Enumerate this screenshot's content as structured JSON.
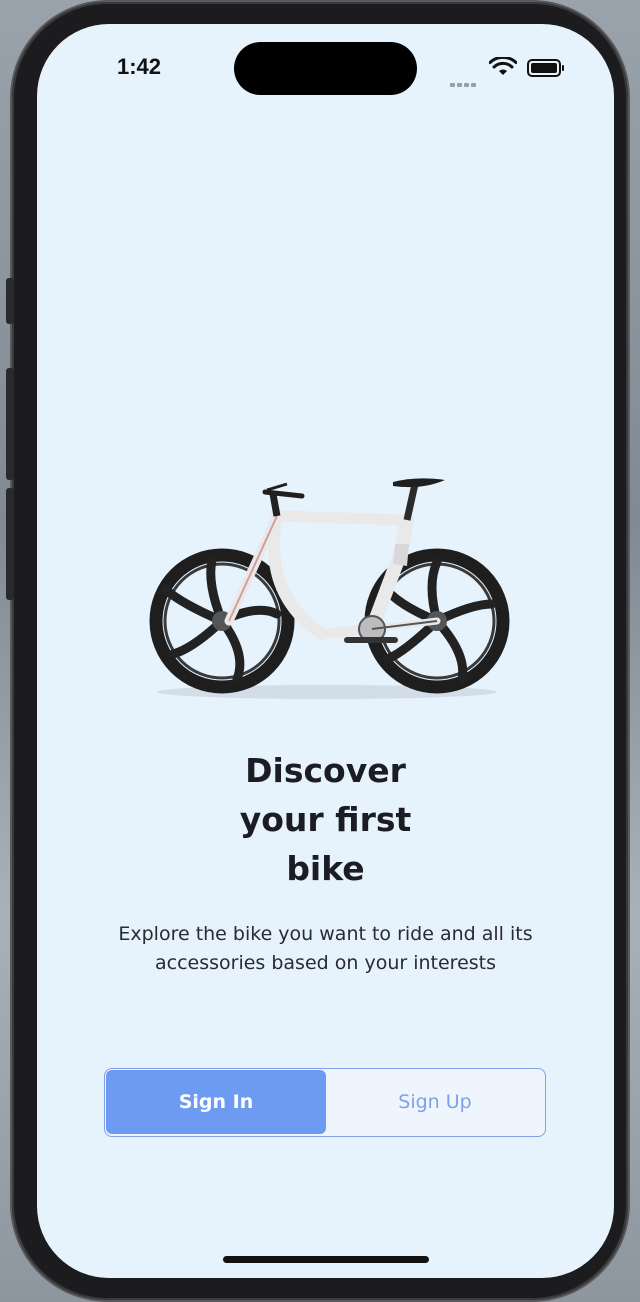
{
  "status_bar": {
    "time": "1:42"
  },
  "hero": {
    "image": "bike-icon",
    "headline_lines": [
      "Discover",
      "your first",
      "bike"
    ],
    "description": "Explore the bike you want to ride and all its accessories based on your interests"
  },
  "auth": {
    "sign_in_label": "Sign In",
    "sign_up_label": "Sign Up",
    "selected": "sign_in"
  },
  "colors": {
    "background": "#e6f2fc",
    "accent": "#6d9bf2",
    "text": "#1c1c24"
  }
}
